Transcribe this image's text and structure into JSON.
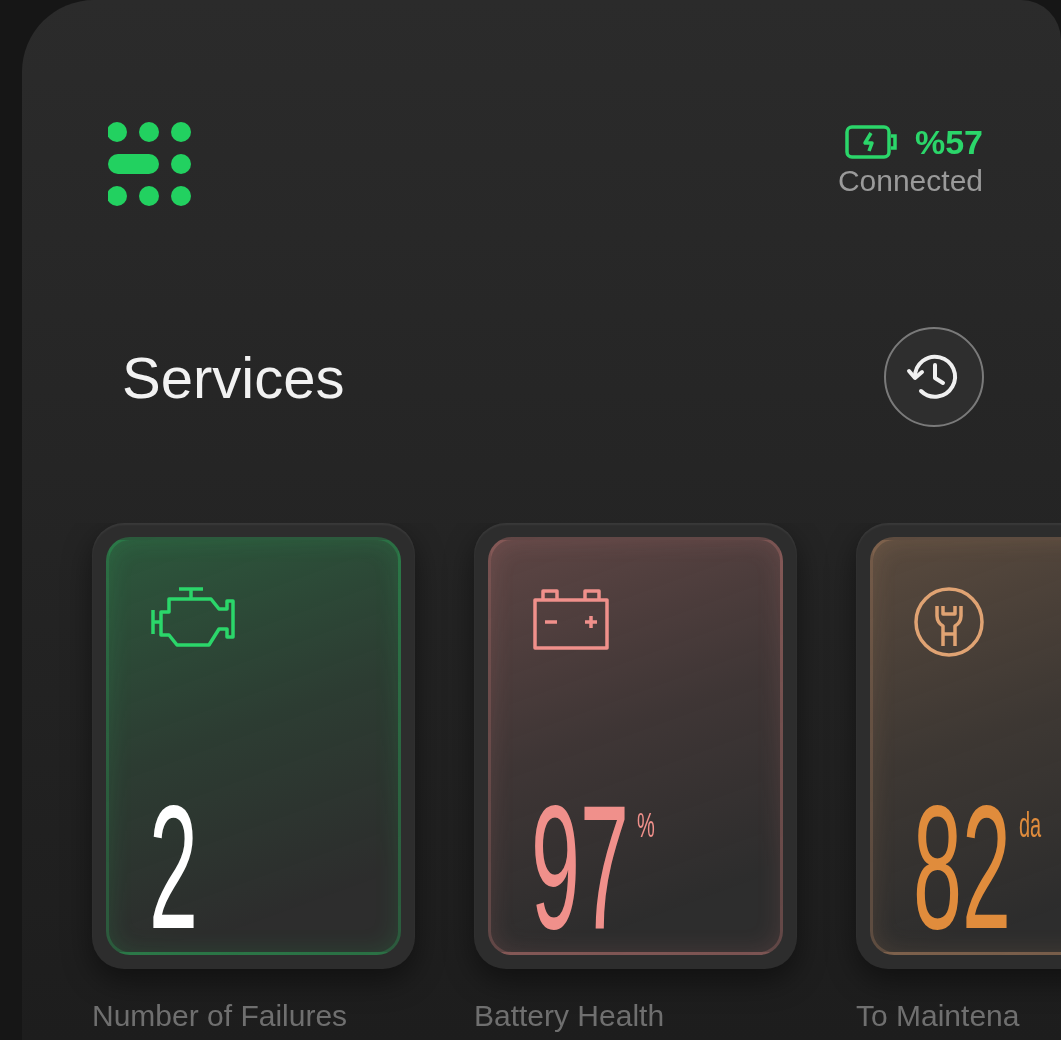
{
  "status": {
    "charge": "%57",
    "connection": "Connected"
  },
  "title": "Services",
  "cards": [
    {
      "kind": "engine",
      "color": "#2bd66a",
      "value": "2",
      "label": "Number of Failures"
    },
    {
      "kind": "battery",
      "color": "#f0908b",
      "value": "97",
      "unit": "%",
      "label": "Battery Health"
    },
    {
      "kind": "maintenance",
      "color": "#e0a373",
      "value": "82",
      "unit": "da",
      "label": "To Maintena"
    }
  ]
}
